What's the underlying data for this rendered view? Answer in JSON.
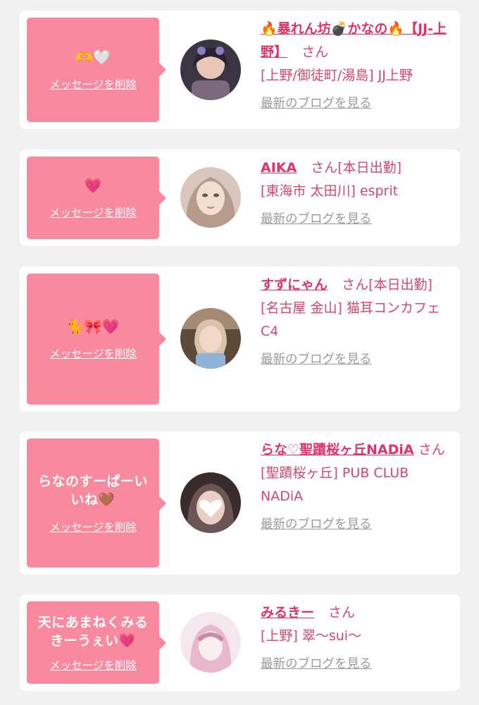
{
  "delete_label": "メッセージを削除",
  "blog_label": "最新のブログを見る",
  "items": [
    {
      "message": "",
      "emoji": "🫶🤍",
      "name": "🔥暴れん坊💣かなの🔥【JJ-上野】",
      "san": "さん",
      "shop": "[上野/御徒町/湯島] JJ上野",
      "avatar_colors": [
        "#3b3442",
        "#7a6a7c",
        "#e8c7b8"
      ]
    },
    {
      "message": "",
      "emoji": "💗",
      "name": "AIKA",
      "san": "さん[本日出勤]",
      "shop": "[東海市 太田川] esprit",
      "avatar_colors": [
        "#d9c6bd",
        "#b69a8c",
        "#f2dfd4"
      ]
    },
    {
      "message": "",
      "emoji": "🐈🎀💗",
      "name": "すずにゃん",
      "san": "さん[本日出勤]",
      "shop": "[名古屋 金山] 猫耳コンカフェ C4",
      "avatar_colors": [
        "#5d4a3a",
        "#a48a72",
        "#f0d8c8"
      ]
    },
    {
      "message": "らなのすーぱーいいね🤎",
      "emoji": "",
      "name": "らな♡聖蹟桜ヶ丘NADiA",
      "san": "さん",
      "shop": "[聖蹟桜ヶ丘] PUB CLUB NADiA",
      "avatar_colors": [
        "#3a2c2c",
        "#6b5555",
        "#ffffff"
      ]
    },
    {
      "message": "天にあまねくみるきーうぇい💗",
      "emoji": "",
      "name": "みるきー",
      "san": "さん",
      "shop": "[上野] 翠〜sui〜",
      "avatar_colors": [
        "#f6e6ee",
        "#e8b9cc",
        "#c98aa6"
      ]
    }
  ]
}
